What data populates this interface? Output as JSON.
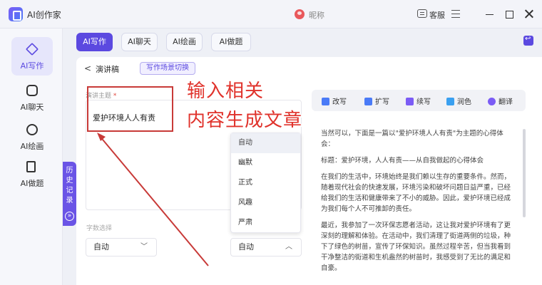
{
  "app": {
    "title": "AI创作家",
    "user_name": "昵称",
    "feedback_label": "客服"
  },
  "top_tabs": [
    {
      "label": "AI写作",
      "active": true
    },
    {
      "label": "AI聊天",
      "active": false
    },
    {
      "label": "AI绘画",
      "active": false
    },
    {
      "label": "AI做题",
      "active": false
    }
  ],
  "sidebar": {
    "items": [
      {
        "label": "AI写作",
        "icon": "pen-icon",
        "active": true
      },
      {
        "label": "AI聊天",
        "icon": "chat-icon",
        "active": false
      },
      {
        "label": "AI绘画",
        "icon": "palette-icon",
        "active": false
      },
      {
        "label": "AI做题",
        "icon": "book-icon",
        "active": false
      }
    ],
    "history_tab": "历史记录",
    "history_expand": "»"
  },
  "breadcrumb": {
    "back": "<",
    "title": "演讲稿",
    "switch_label": "写作场景切换"
  },
  "form": {
    "topic_label": "演讲主题",
    "required_mark": "*",
    "topic_value": "爱护环境人人有责",
    "word_count_label": "字数选择",
    "word_count_value": "自动",
    "tone_value": "自动",
    "tone_options": [
      "自动",
      "幽默",
      "正式",
      "风趣",
      "严肃"
    ],
    "tone_selected_index": 0
  },
  "annotation": {
    "line1": "输入相关",
    "line2": "内容生成文章",
    "color": "#e0322b"
  },
  "toolbar": {
    "items": [
      {
        "label": "改写",
        "icon": "rewrite-icon",
        "color": "#4a7bf7"
      },
      {
        "label": "扩写",
        "icon": "expand-icon",
        "color": "#4a7bf7"
      },
      {
        "label": "续写",
        "icon": "continue-icon",
        "color": "#7b5cf5"
      },
      {
        "label": "润色",
        "icon": "polish-icon",
        "color": "#3aa0f0"
      },
      {
        "label": "翻译",
        "icon": "translate-icon",
        "color": "#7b5cf5"
      }
    ]
  },
  "output": {
    "paragraphs": [
      "当然可以，下面是一篇以\"爱护环境人人有责\"为主题的心得体会：",
      "标题：爱护环境，人人有责——从自我做起的心得体会",
      "在我们的生活中，环境始终是我们赖以生存的重要条件。然而，随着现代社会的快速发展，环境污染和破坏问题日益严重，已经给我们的生活和健康带来了不小的威胁。因此，爱护环境已经成为我们每个人不可推卸的责任。",
      "最近，我参加了一次环保志愿者活动，这让我对爱护环境有了更深刻的理解和体验。在活动中，我们清理了街道两侧的垃圾，种下了绿色的树苗，宣传了环保知识。虽然过程辛苦，但当我看到干净整洁的街道和生机盎然的树苗时，我感受到了无比的满足和自豪。"
    ]
  },
  "colors": {
    "accent": "#5b49e0",
    "annotation_red": "#c83a38"
  }
}
